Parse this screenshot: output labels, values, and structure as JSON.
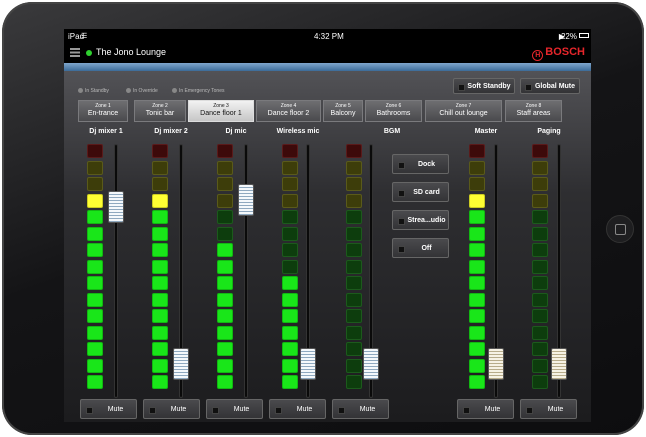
{
  "device": {
    "name": "iPad"
  },
  "status_bar": {
    "carrier": "iPad",
    "time": "4:32 PM",
    "battery": "22%"
  },
  "header": {
    "title": "The Jono Lounge",
    "brand": "BOSCH",
    "online_color": "#2fd02f"
  },
  "legend": [
    "In Standby",
    "In Override",
    "In Emergency Tones"
  ],
  "global_buttons": {
    "soft_standby": "Soft Standby",
    "global_mute": "Global Mute"
  },
  "zones": [
    {
      "num": "Zone 1",
      "name": "En-trance",
      "selected": false
    },
    {
      "num": "Zone 2",
      "name": "Tonic bar",
      "selected": false
    },
    {
      "num": "Zone 3",
      "name": "Dance floor 1",
      "selected": true
    },
    {
      "num": "Zone 4",
      "name": "Dance floor 2",
      "selected": false
    },
    {
      "num": "Zone 5",
      "name": "Balcony",
      "selected": false
    },
    {
      "num": "Zone 6",
      "name": "Bathrooms",
      "selected": false
    },
    {
      "num": "Zone 7",
      "name": "Chill out lounge",
      "selected": false
    },
    {
      "num": "Zone 8",
      "name": "Staff areas",
      "selected": false
    }
  ],
  "channels": [
    {
      "label": "Dj mixer 1",
      "level": 12,
      "fader": 0.79,
      "knob": "blue",
      "mute": "Mute"
    },
    {
      "label": "Dj mixer 2",
      "level": 12,
      "fader": 0.08,
      "knob": "blue",
      "mute": "Mute"
    },
    {
      "label": "Dj mic",
      "level": 9,
      "fader": 0.82,
      "knob": "blue",
      "mute": "Mute"
    },
    {
      "label": "Wireless mic",
      "level": 7,
      "fader": 0.08,
      "knob": "blue",
      "mute": "Mute"
    },
    {
      "label": "BGM",
      "level": 0,
      "fader": 0.08,
      "knob": "blue",
      "mute": "Mute"
    },
    {
      "label": "Master",
      "level": 12,
      "fader": 0.08,
      "knob": "beige",
      "mute": "Mute"
    },
    {
      "label": "Paging",
      "level": 0,
      "fader": 0.08,
      "knob": "beige",
      "mute": "Mute"
    }
  ],
  "bgm_sources": [
    "Dock",
    "SD card",
    "Strea...udio",
    "Off"
  ],
  "colors": {
    "green_on": "#19e619",
    "green_off": "#0d3d0d",
    "yellow_on": "#ffff33",
    "yellow_off": "#3d3d0a",
    "red_off": "#3d0a0a",
    "seg_border_off": "#222"
  }
}
